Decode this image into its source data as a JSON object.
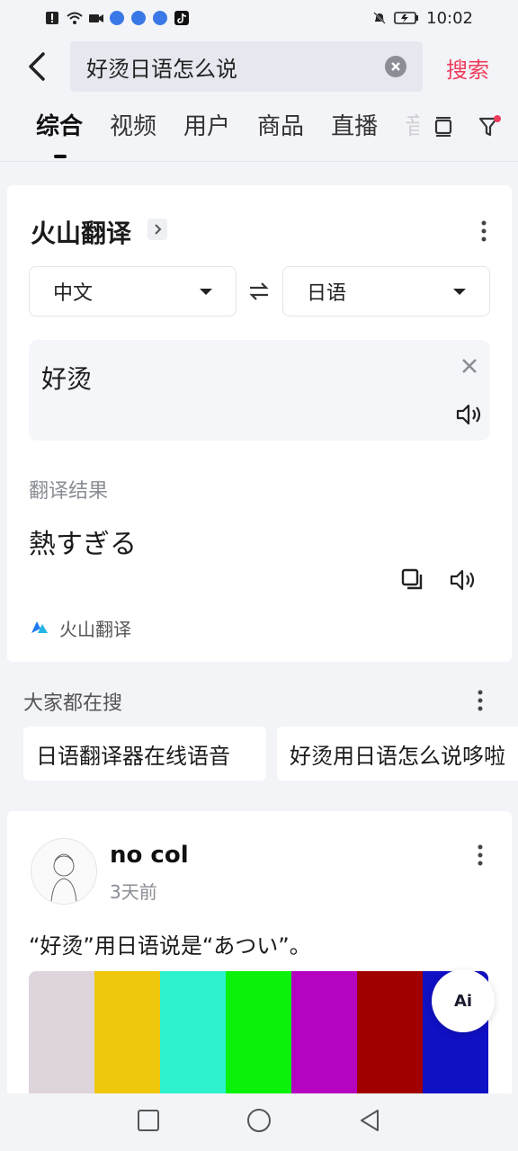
{
  "status_bar": {
    "time": "10:02"
  },
  "search": {
    "query": "好烫日语怎么说",
    "submit_label": "搜索"
  },
  "tabs": [
    "综合",
    "视频",
    "用户",
    "商品",
    "直播",
    "音"
  ],
  "translator": {
    "title": "火山翻译",
    "source_lang": "中文",
    "target_lang": "日语",
    "input_text": "好烫",
    "result_label": "翻译结果",
    "result_text": "熱すぎる",
    "brand": "火山翻译"
  },
  "hot_searches": {
    "title": "大家都在搜",
    "items": [
      "日语翻译器在线语音",
      "好烫用日语怎么说哆啦"
    ]
  },
  "post": {
    "author": "no col",
    "time": "3天前",
    "text": "“好烫”用日语说是“あつい”。",
    "bar_colors": [
      "#ddd4dc",
      "#efc70d",
      "#2ef2cd",
      "#0bf10a",
      "#b404c0",
      "#a00000",
      "#1010c4"
    ]
  },
  "ai_button": {
    "label": "Ai"
  }
}
